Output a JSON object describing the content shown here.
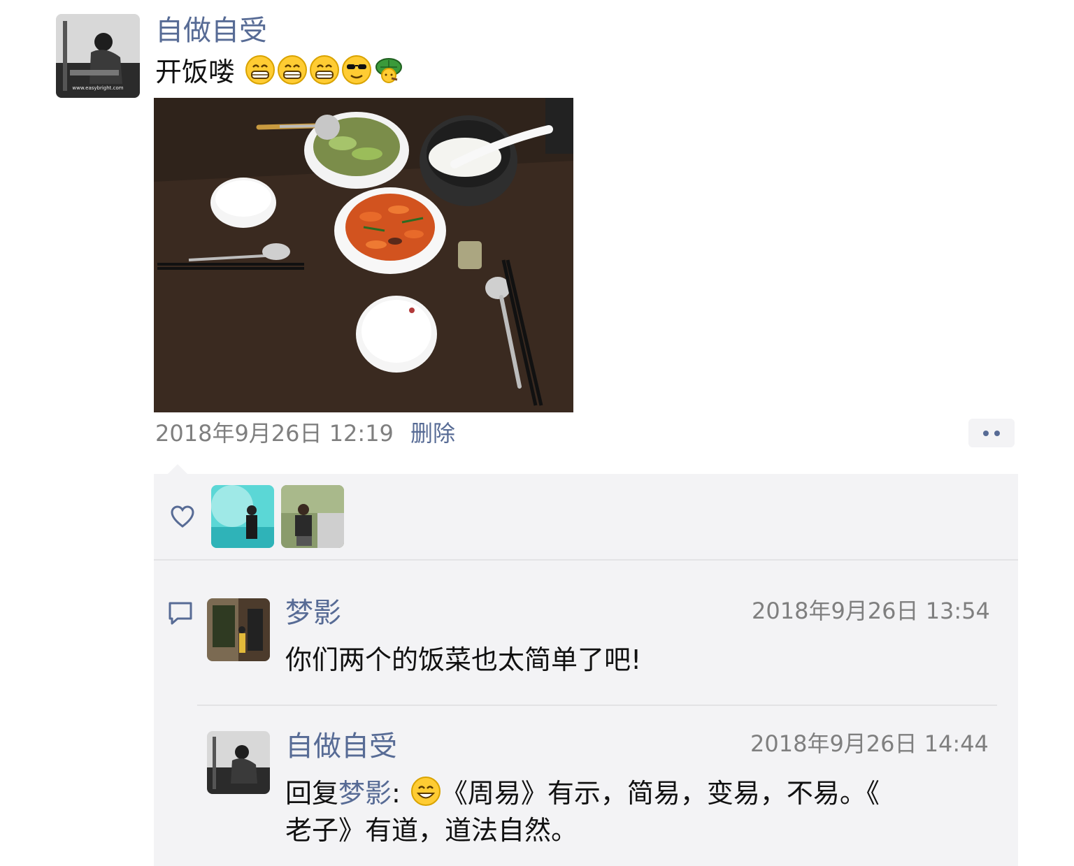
{
  "post": {
    "author": "自做自受",
    "text": "开饭喽",
    "emojis": [
      "grin-emoji",
      "grin-emoji",
      "grin-emoji",
      "cool-sunglasses-emoji",
      "turtle-emoji"
    ],
    "photo_alt": "晚餐照片",
    "time": "2018年9月26日 12:19",
    "delete_label": "删除"
  },
  "likes": {
    "icon": "heart-icon",
    "avatars": [
      "liker-avatar-1",
      "liker-avatar-2"
    ]
  },
  "comments": [
    {
      "author": "梦影",
      "time": "2018年9月26日 13:54",
      "text": "你们两个的饭菜也太简单了吧!"
    },
    {
      "author": "自做自受",
      "time": "2018年9月26日 14:44",
      "reply_prefix": "回复",
      "reply_to": "梦影",
      "colon": ": ",
      "text_line1": "《周易》有示，简易，变易，不易。《",
      "text_line2": "老子》有道，道法自然。"
    }
  ],
  "colors": {
    "link": "#576b95",
    "panel": "#f3f3f5",
    "table": "#3a2a20"
  }
}
